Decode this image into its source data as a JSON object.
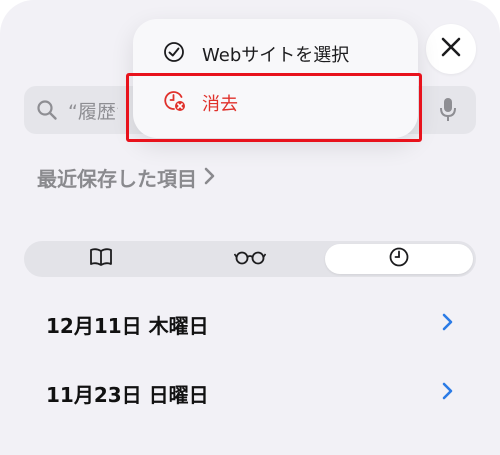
{
  "search": {
    "placeholder": "“履歴”を"
  },
  "recent_saved": {
    "label": "最近保存した項目"
  },
  "segments": {
    "items": [
      {
        "icon": "book-icon"
      },
      {
        "icon": "glasses-icon"
      },
      {
        "icon": "clock-icon",
        "selected": true
      }
    ]
  },
  "history": {
    "rows": [
      {
        "label": "12月11日 木曜日"
      },
      {
        "label": "11月23日 日曜日"
      }
    ]
  },
  "menu": {
    "items": [
      {
        "label": "Webサイトを選択",
        "icon": "checkmark-circle-icon"
      },
      {
        "label": "消去",
        "icon": "clear-history-icon",
        "color": "#e0312b"
      }
    ]
  },
  "colors": {
    "accent": "#2b7be6",
    "destructive": "#e0312b",
    "annotation_outline": "#e8121c"
  }
}
